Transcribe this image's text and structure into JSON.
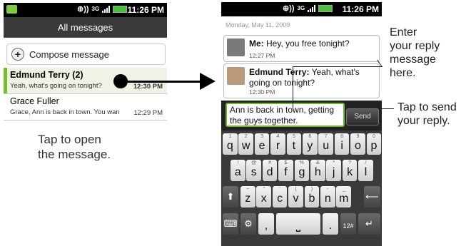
{
  "left_phone": {
    "status_time": "11:26 PM",
    "title": "All messages",
    "compose_label": "Compose message",
    "threads": [
      {
        "name": "Edmund Terry (2)",
        "snippet": "Yeah, what's going on tonight?",
        "time": "12:30 PM"
      },
      {
        "name": "Grace Fuller",
        "snippet": "Grace, Ann is back in town. You wan",
        "time": "12:29 PM"
      }
    ],
    "hint": [
      "Tap to open",
      "the message."
    ]
  },
  "right_phone": {
    "status_time": "11:26 PM",
    "date": "Monday, May 11, 2009",
    "messages": [
      {
        "sender": "Me:",
        "text": " Hey, you free tonight?",
        "time": "12:27 PM"
      },
      {
        "sender": "Edmund Terry:",
        "text": " Yeah, what's going on tonight?",
        "time": "12:30 PM"
      }
    ],
    "input_value": "Ann is back in town, getting the guys together.",
    "send_label": "Send"
  },
  "keyboard": {
    "row1": [
      {
        "k": "q",
        "s": "1"
      },
      {
        "k": "w",
        "s": "2"
      },
      {
        "k": "e",
        "s": "3"
      },
      {
        "k": "r",
        "s": "4"
      },
      {
        "k": "t",
        "s": "5"
      },
      {
        "k": "y",
        "s": "6"
      },
      {
        "k": "u",
        "s": "7"
      },
      {
        "k": "i",
        "s": "8"
      },
      {
        "k": "o",
        "s": "9"
      },
      {
        "k": "p",
        "s": "0"
      }
    ],
    "row2": [
      {
        "k": "a",
        "s": "!"
      },
      {
        "k": "s",
        "s": "@"
      },
      {
        "k": "d",
        "s": "#"
      },
      {
        "k": "f",
        "s": "$"
      },
      {
        "k": "g",
        "s": "%"
      },
      {
        "k": "h",
        "s": "&"
      },
      {
        "k": "j",
        "s": "*"
      },
      {
        "k": "k",
        "s": "?"
      },
      {
        "k": "l",
        "s": "/"
      }
    ],
    "row3": [
      {
        "k": "z",
        "s": "~"
      },
      {
        "k": "x",
        "s": "\""
      },
      {
        "k": "c",
        "s": "'"
      },
      {
        "k": "v",
        "s": "("
      },
      {
        "k": "b",
        "s": ")"
      },
      {
        "k": "n",
        "s": "-"
      },
      {
        "k": "m",
        "s": "_"
      }
    ],
    "comma": ",",
    "period": ".",
    "symbols_label": "12#"
  },
  "callouts": {
    "enter": [
      "Enter",
      "your reply",
      "message",
      "here."
    ],
    "send": [
      "Tap to send",
      "your reply."
    ]
  }
}
